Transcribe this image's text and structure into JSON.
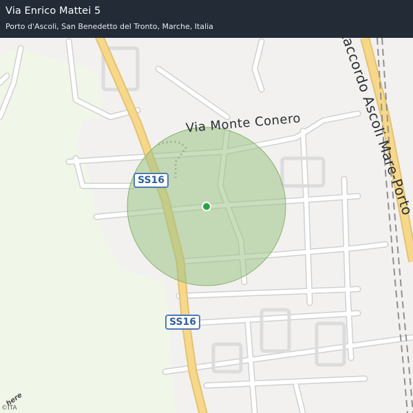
{
  "header": {
    "title": "Via Enrico Mattei 5",
    "subtitle": "Porto d'Ascoli, San Benedetto del Tronto, Marche, Italia"
  },
  "map": {
    "street_label": "Via  Monte  Conero",
    "highway_label": "Raccordo Ascoli Mare-Porto",
    "shields": [
      "SS16",
      "SS16"
    ],
    "copyright": "©ITA",
    "brand": "here",
    "colors": {
      "background": "#f2f1ef",
      "park": "#f1f7e8",
      "major_road": "#f7d88a",
      "minor_road": "#ffffff",
      "radius_circle": "#9cc285",
      "location_dot": "#2aa542",
      "header": "#222b36"
    }
  }
}
